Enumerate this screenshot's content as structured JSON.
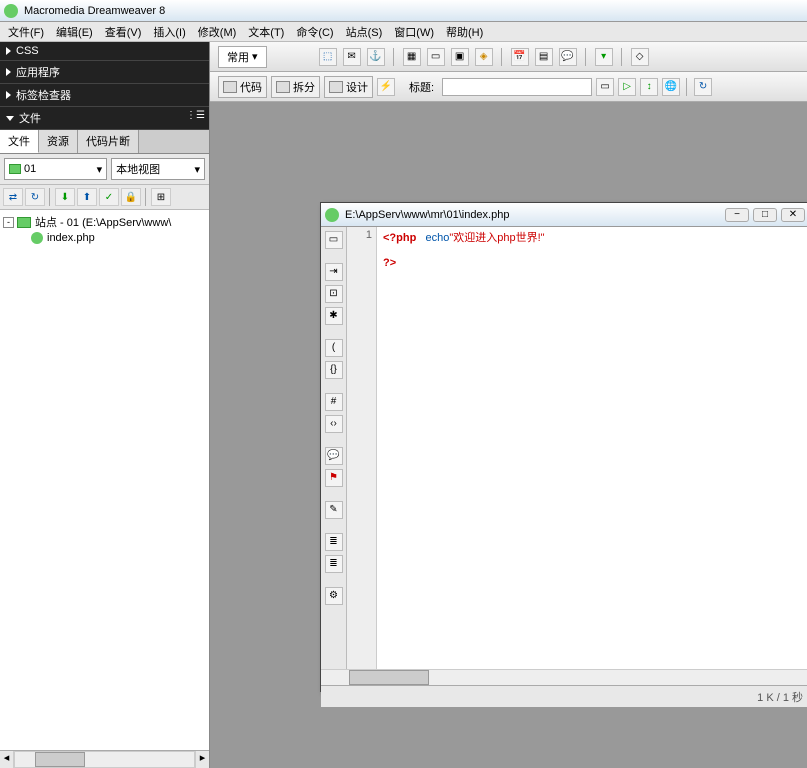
{
  "app_title": "Macromedia Dreamweaver 8",
  "menu": [
    "文件(F)",
    "编辑(E)",
    "查看(V)",
    "插入(I)",
    "修改(M)",
    "文本(T)",
    "命令(C)",
    "站点(S)",
    "窗口(W)",
    "帮助(H)"
  ],
  "panels": {
    "css": "CSS",
    "app": "应用程序",
    "tag": "标签检查器",
    "files": "文件"
  },
  "file_tabs": {
    "files": "文件",
    "assets": "资源",
    "snippets": "代码片断"
  },
  "site_selector": "01",
  "view_selector": "本地视图",
  "tree": {
    "root": "站点 - 01 (E:\\AppServ\\www\\",
    "file": "index.php"
  },
  "insert_dropdown": "常用",
  "view_buttons": {
    "code": "代码",
    "split": "拆分",
    "design": "设计"
  },
  "title_label": "标题:",
  "title_value": "",
  "doc_path": "E:\\AppServ\\www\\mr\\01\\index.php",
  "line_no": "1",
  "code_line": {
    "open": "<?php",
    "fn": "echo",
    "str": "\"欢迎进入php世界!\"",
    "close": "?>"
  },
  "status": "1 K / 1 秒"
}
